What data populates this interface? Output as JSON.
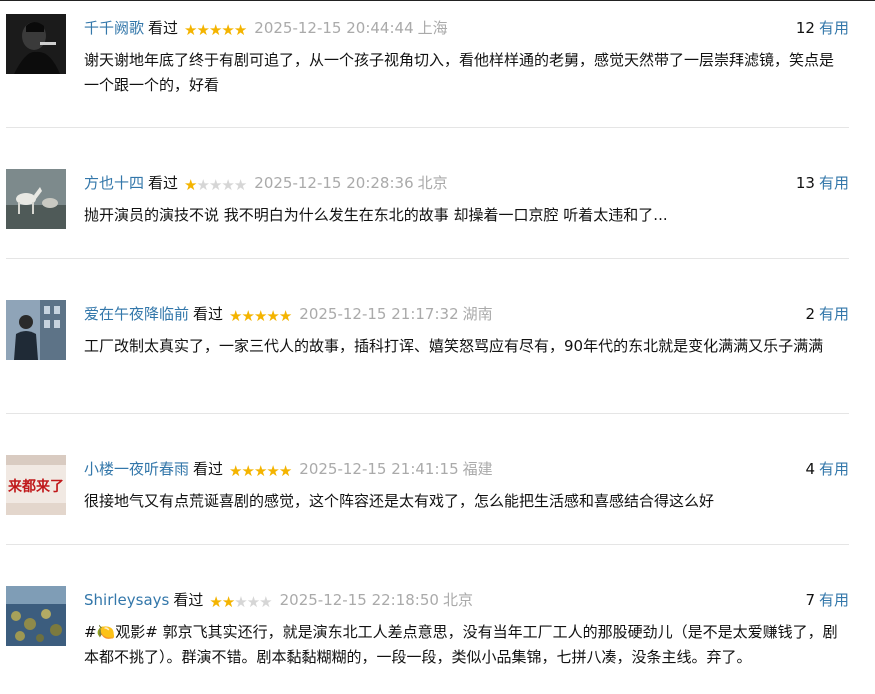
{
  "comments": [
    {
      "user": "千千阙歌",
      "status": "看过",
      "rating": 5,
      "time": "2025-12-15 20:44:44",
      "location": "上海",
      "votes": "12",
      "vote_label": "有用",
      "text": "谢天谢地年底了终于有剧可追了，从一个孩子视角切入，看他样样通的老舅，感觉天然带了一层崇拜滤镜，笑点是一个跟一个的，好看"
    },
    {
      "user": "方也十四",
      "status": "看过",
      "rating": 1,
      "time": "2025-12-15 20:28:36",
      "location": "北京",
      "votes": "13",
      "vote_label": "有用",
      "text": "抛开演员的演技不说 我不明白为什么发生在东北的故事 却操着一口京腔 听着太违和了..."
    },
    {
      "user": "爱在午夜降临前",
      "status": "看过",
      "rating": 5,
      "time": "2025-12-15 21:17:32",
      "location": "湖南",
      "votes": "2",
      "vote_label": "有用",
      "text": "工厂改制太真实了，一家三代人的故事，插科打诨、嬉笑怒骂应有尽有，90年代的东北就是变化满满又乐子满满"
    },
    {
      "user": "小楼一夜听春雨",
      "status": "看过",
      "rating": 5,
      "time": "2025-12-15 21:41:15",
      "location": "福建",
      "votes": "4",
      "vote_label": "有用",
      "text": "很接地气又有点荒诞喜剧的感觉，这个阵容还是太有戏了，怎么能把生活感和喜感结合得这么好",
      "avatar_text": "来都来了"
    },
    {
      "user": "Shirleysays",
      "status": "看过",
      "rating": 2,
      "time": "2025-12-15 22:18:50",
      "location": "北京",
      "votes": "7",
      "vote_label": "有用",
      "text": "#🍋观影# 郭京飞其实还行，就是演东北工人差点意思，没有当年工厂工人的那股硬劲儿（是不是太爱赚钱了，剧本都不挑了）。群演不错。剧本黏黏糊糊的，一段一段，类似小品集锦，七拼八凑，没条主线。弃了。"
    }
  ],
  "colors": {
    "link": "#3377aa",
    "star_on": "#f4b400",
    "star_off": "#d6d6d6",
    "meta_gray": "#aaaaaa",
    "divider": "#e5e5e5"
  }
}
